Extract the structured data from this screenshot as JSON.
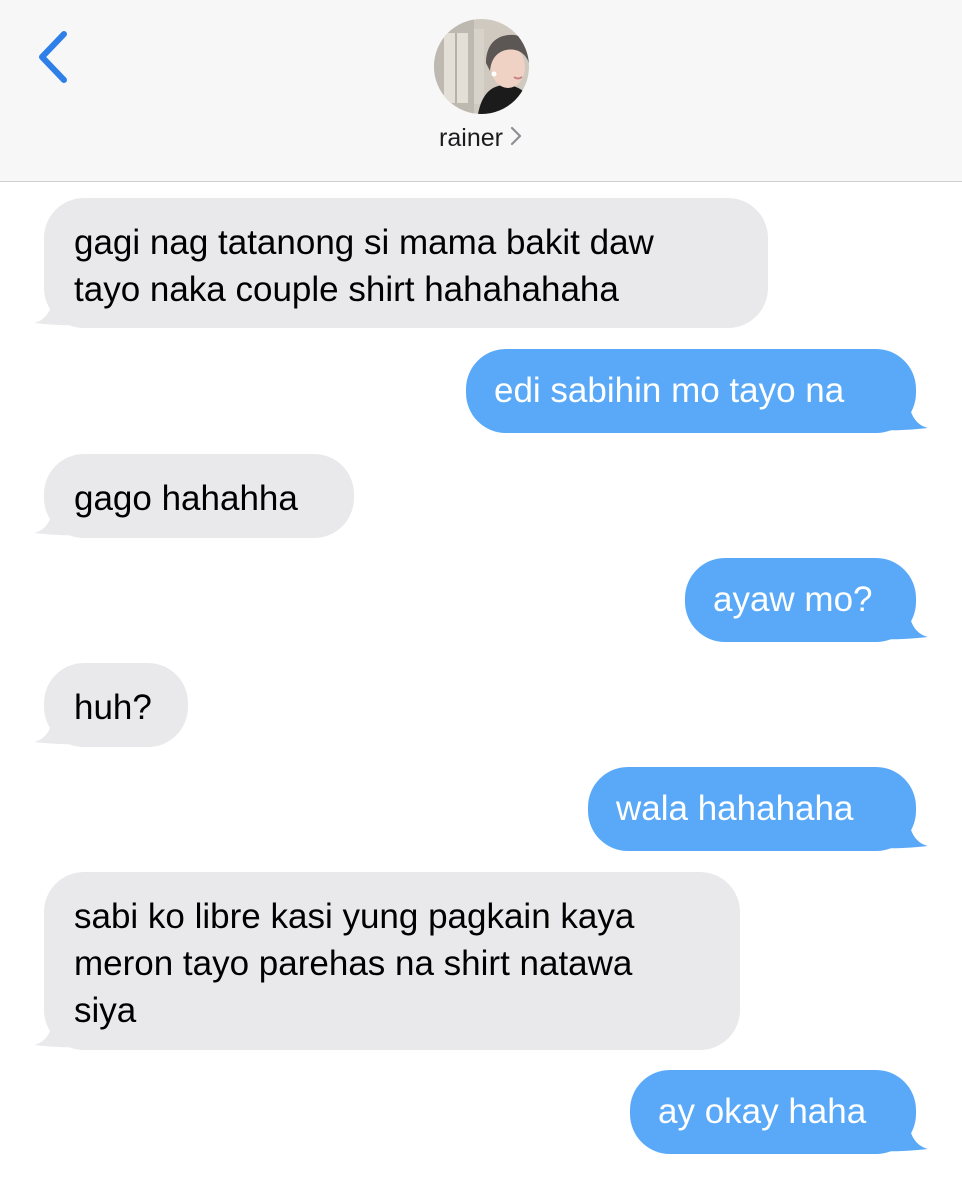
{
  "header": {
    "back_icon": "chevron-left-icon",
    "contact_name": "rainer",
    "contact_chevron_icon": "chevron-right-icon",
    "avatar_icon": "contact-photo"
  },
  "colors": {
    "accent": "#2f7fe9",
    "incoming_bubble": "#e9e9eb",
    "outgoing_bubble": "#59a9f8",
    "header_bg": "#f7f7f7"
  },
  "messages": [
    {
      "direction": "incoming",
      "lines": [
        "gagi nag tatanong si mama bakit daw",
        "tayo naka couple shirt hahahahaha"
      ]
    },
    {
      "direction": "outgoing",
      "lines": [
        "edi sabihin mo tayo na"
      ]
    },
    {
      "direction": "incoming",
      "lines": [
        "gago hahahha"
      ]
    },
    {
      "direction": "outgoing",
      "lines": [
        "ayaw mo?"
      ]
    },
    {
      "direction": "incoming",
      "lines": [
        "huh?"
      ]
    },
    {
      "direction": "outgoing",
      "lines": [
        "wala hahahaha"
      ]
    },
    {
      "direction": "incoming",
      "lines": [
        "sabi ko libre kasi yung pagkain kaya",
        "meron tayo parehas na shirt natawa",
        "siya"
      ]
    },
    {
      "direction": "outgoing",
      "lines": [
        "ay okay haha"
      ]
    }
  ]
}
